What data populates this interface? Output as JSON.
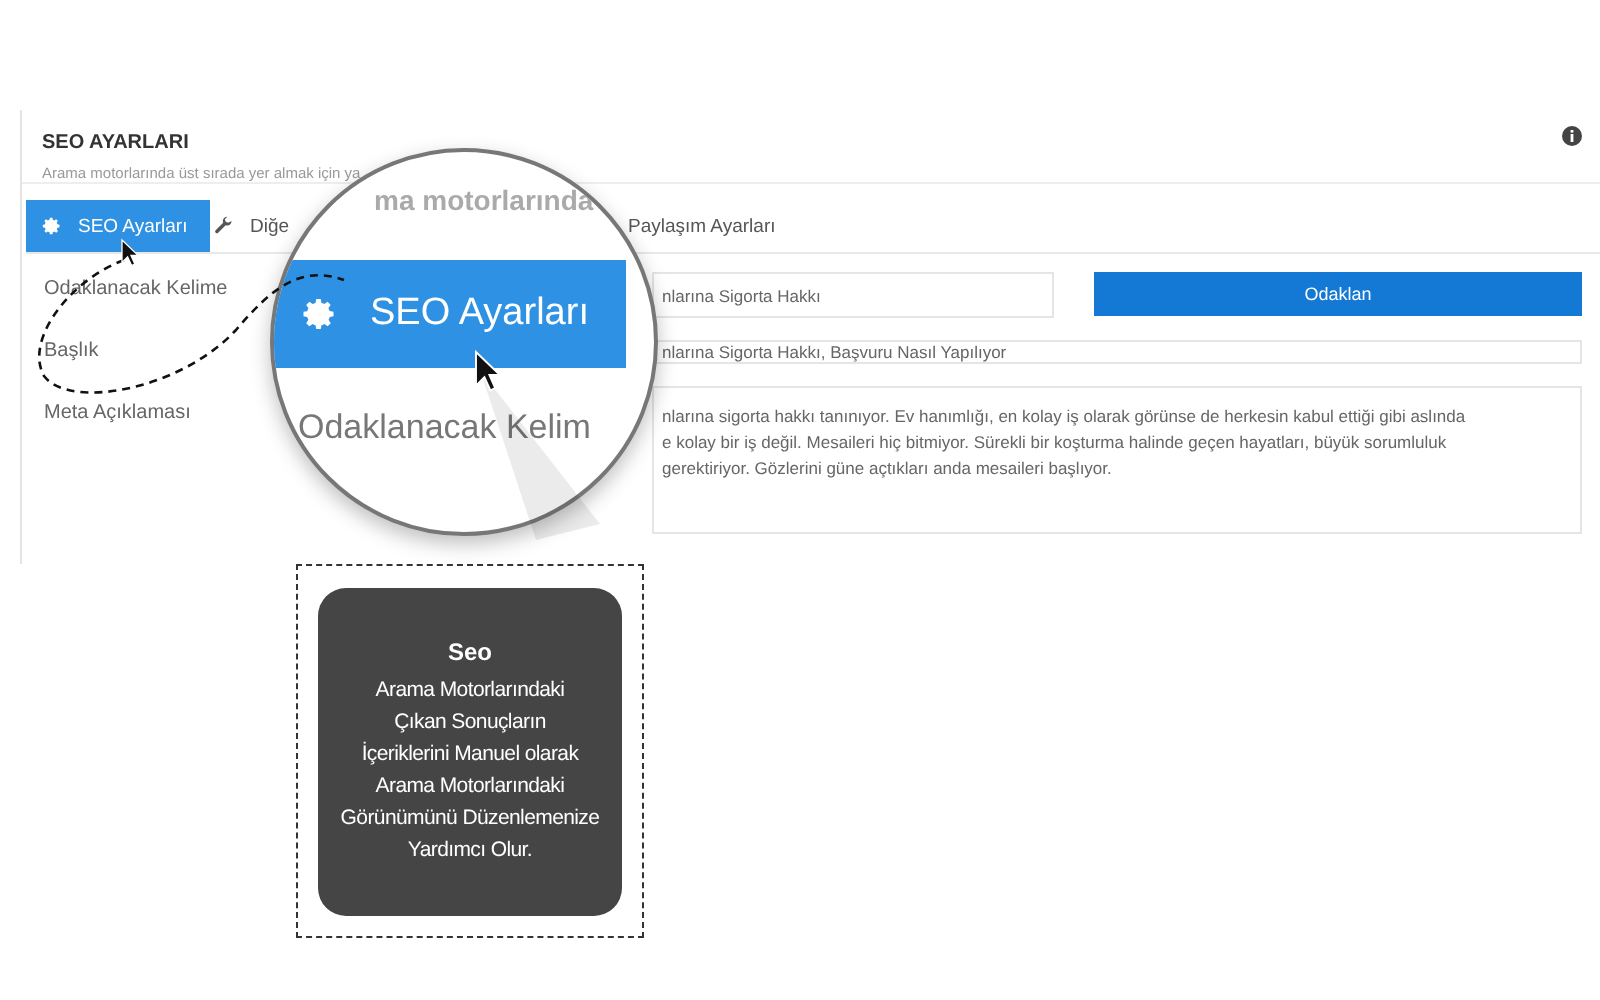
{
  "panel": {
    "title": "SEO AYARLARI",
    "subtitle": "Arama motorlarında üst sırada yer almak için ya"
  },
  "tabs": [
    {
      "label": "SEO Ayarları",
      "selected": true
    },
    {
      "label": "Diğe",
      "selected": false
    },
    {
      "label": "Paylaşım Ayarları",
      "selected": false
    }
  ],
  "labels": [
    "Odaklanacak Kelime",
    "Başlık",
    "Meta Açıklaması"
  ],
  "focus_field": {
    "value": "nlarına Sigorta Hakkı"
  },
  "focus_button": "Odaklan",
  "title_field": {
    "value": "nlarına Sigorta Hakkı, Başvuru Nasıl Yapılıyor"
  },
  "meta_field": {
    "lines": [
      "nlarına sigorta hakkı tanınıyor. Ev hanımlığı, en kolay iş olarak görünse de herkesin kabul ettiği gibi aslında",
      "e kolay bir iş değil. Mesaileri hiç bitmiyor. Sürekli bir koşturma halinde geçen hayatları, büyük sorumluluk",
      "gerektiriyor. Gözlerini güne açtıkları anda mesaileri başlıyor."
    ]
  },
  "magnifier": {
    "subtitle": "ma motorlarında",
    "tab": "SEO Ayarları",
    "label": "Odaklanacak Kelim"
  },
  "tooltip": {
    "title": "Seo",
    "lines": [
      "Arama Motorlarındaki",
      "Çıkan Sonuçların",
      "İçeriklerini Manuel olarak",
      "Arama Motorlarındaki",
      "Görünümünü Düzenlemenize",
      "Yardımcı Olur."
    ]
  }
}
